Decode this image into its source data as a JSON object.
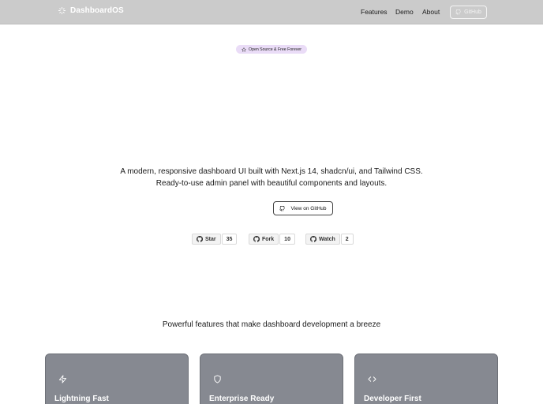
{
  "nav": {
    "brand": "DashboardOS",
    "links": [
      "Features",
      "Demo",
      "About"
    ],
    "github_label": "GitHub"
  },
  "hero": {
    "badge": "Open Source & Free Forever",
    "tagline": "A modern, responsive dashboard UI built with Next.js 14, shadcn/ui, and Tailwind CSS. Ready-to-use admin panel with beautiful components and layouts.",
    "cta": "View on GitHub"
  },
  "github_buttons": [
    {
      "label": "Star",
      "count": "35"
    },
    {
      "label": "Fork",
      "count": "10"
    },
    {
      "label": "Watch",
      "count": "2"
    }
  ],
  "features": {
    "subtitle": "Powerful features that make dashboard development a breeze",
    "cards": [
      {
        "title": "Lightning Fast",
        "icon": "lightning-icon"
      },
      {
        "title": "Enterprise Ready",
        "icon": "shield-icon"
      },
      {
        "title": "Developer First",
        "icon": "code-icon"
      }
    ]
  },
  "colors": {
    "navbar": "#cbcbcb",
    "badge": "#eadcf7",
    "card": "#868991"
  }
}
